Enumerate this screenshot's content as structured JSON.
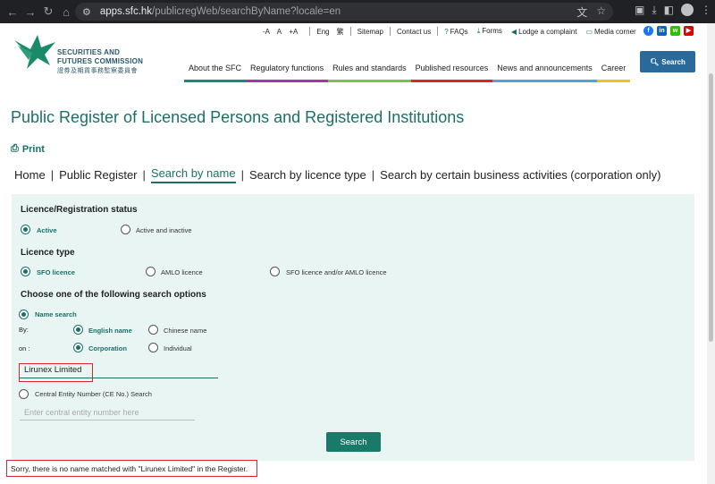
{
  "browser": {
    "url_host": "apps.sfc.hk",
    "url_path": "/publicregWeb/searchByName?locale=en"
  },
  "header": {
    "logo_line1": "SECURITIES AND",
    "logo_line2": "FUTURES COMMISSION",
    "logo_line3": "證券及期貨事務監察委員會",
    "font_sizes": [
      "-A",
      "A",
      "+A"
    ],
    "lang_en": "Eng",
    "lang_zh": "繁",
    "sitemap": "Sitemap",
    "contact": "Contact us",
    "faqs": "FAQs",
    "forms": "Forms",
    "complaint": "Lodge a complaint",
    "media": "Media corner",
    "search_button": "Search",
    "nav": [
      {
        "label": "About the SFC",
        "color": "#1a8a7a"
      },
      {
        "label": "Regulatory functions",
        "color": "#a03aa0"
      },
      {
        "label": "Rules and standards",
        "color": "#7ac04a"
      },
      {
        "label": "Published resources",
        "color": "#d9262c"
      },
      {
        "label": "News and announcements",
        "color": "#5aa0d0"
      },
      {
        "label": "Career",
        "color": "#f0c020"
      }
    ]
  },
  "page": {
    "title": "Public Register of Licensed Persons and Registered Institutions",
    "print": "Print",
    "breadcrumb": [
      "Home",
      "Public Register",
      "Search by name",
      "Search by licence type",
      "Search by certain business activities (corporation only)"
    ]
  },
  "form": {
    "status_heading": "Licence/Registration status",
    "status_active": "Active",
    "status_both": "Active and inactive",
    "type_heading": "Licence type",
    "type_sfo": "SFO licence",
    "type_amlo": "AMLO licence",
    "type_either": "SFO licence and/or AMLO licence",
    "options_heading": "Choose one of the following search options",
    "name_search": "Name search",
    "by_label": "By:",
    "by_english": "English name",
    "by_chinese": "Chinese name",
    "on_label": "on :",
    "on_corp": "Corporation",
    "on_indiv": "Individual",
    "name_value": "Lirunex Limited",
    "ce_search": "Central Entity Number (CE No.) Search",
    "ce_placeholder": "Enter central entity number here",
    "submit": "Search"
  },
  "result_message": "Sorry, there is no name matched with \"Lirunex Limited\" in the Register.",
  "colors": {
    "accent": "#1a6f6a",
    "highlight": "#d9262c",
    "panel": "#e8f5f3"
  }
}
